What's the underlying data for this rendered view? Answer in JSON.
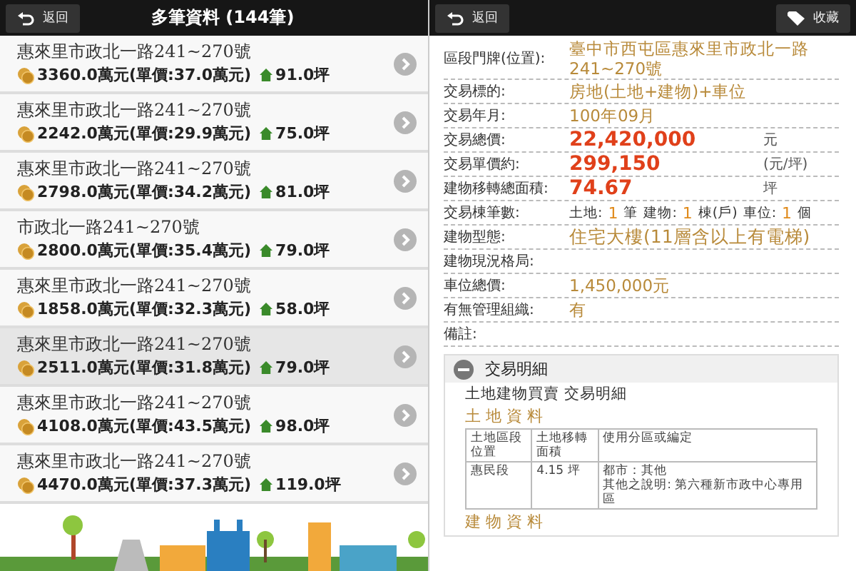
{
  "left": {
    "back_button": "返回",
    "title": "多筆資料 (144筆)",
    "items": [
      {
        "address": "惠來里市政北一路241~270號",
        "price": "3360.0萬元(單價:37.0萬元)",
        "area": "91.0坪",
        "selected": false
      },
      {
        "address": "惠來里市政北一路241~270號",
        "price": "2242.0萬元(單價:29.9萬元)",
        "area": "75.0坪",
        "selected": false
      },
      {
        "address": "惠來里市政北一路241~270號",
        "price": "2798.0萬元(單價:34.2萬元)",
        "area": "81.0坪",
        "selected": false
      },
      {
        "address": "市政北一路241~270號",
        "price": "2800.0萬元(單價:35.4萬元)",
        "area": "79.0坪",
        "selected": false
      },
      {
        "address": "惠來里市政北一路241~270號",
        "price": "1858.0萬元(單價:32.3萬元)",
        "area": "58.0坪",
        "selected": false
      },
      {
        "address": "惠來里市政北一路241~270號",
        "price": "2511.0萬元(單價:31.8萬元)",
        "area": "79.0坪",
        "selected": true
      },
      {
        "address": "惠來里市政北一路241~270號",
        "price": "4108.0萬元(單價:43.5萬元)",
        "area": "98.0坪",
        "selected": false
      },
      {
        "address": "惠來里市政北一路241~270號",
        "price": "4470.0萬元(單價:37.3萬元)",
        "area": "119.0坪",
        "selected": false
      }
    ]
  },
  "right": {
    "back_button": "返回",
    "favorite_button": "收藏",
    "fields": [
      {
        "kind": "text",
        "label": "區段門牌(位置):",
        "value": "臺中市西屯區惠來里市政北一路241~270號"
      },
      {
        "kind": "text",
        "label": "交易標的:",
        "value": "房地(土地+建物)+車位"
      },
      {
        "kind": "text",
        "label": "交易年月:",
        "value": "100年09月"
      },
      {
        "kind": "amount",
        "label": "交易總價:",
        "value": "22,420,000",
        "unit": "元"
      },
      {
        "kind": "amount",
        "label": "交易單價約:",
        "value": "299,150",
        "unit": "(元/坪)"
      },
      {
        "kind": "amount",
        "label": "建物移轉總面積:",
        "value": "74.67",
        "unit": "坪"
      },
      {
        "kind": "counts",
        "label": "交易棟筆數:",
        "parts": [
          {
            "label": "土地:",
            "value": "1",
            "unit": "筆"
          },
          {
            "label": "建物:",
            "value": "1",
            "unit": "棟(戶)"
          },
          {
            "label": "車位:",
            "value": "1",
            "unit": "個"
          }
        ]
      },
      {
        "kind": "large",
        "label": "建物型態:",
        "value": "住宅大樓(11層含以上有電梯)"
      },
      {
        "kind": "empty",
        "label": "建物現況格局:"
      },
      {
        "kind": "text",
        "label": "車位總價:",
        "value": "1,450,000元"
      },
      {
        "kind": "text",
        "label": "有無管理組織:",
        "value": "有"
      },
      {
        "kind": "empty",
        "label": "備註:"
      }
    ],
    "detail": {
      "title": "交易明細",
      "expanded": true,
      "subtitle": "土地建物買賣  交易明細",
      "land_heading": "土 地 資 料",
      "columns": [
        "土地區段位置",
        "土地移轉面積",
        "使用分區或編定"
      ],
      "rows": [
        [
          "惠民段",
          "4.15 坪",
          [
            "都市：其他",
            "其他之說明: 第六種新市政中心專用區"
          ]
        ]
      ],
      "building_heading": "建 物 資 料"
    }
  }
}
